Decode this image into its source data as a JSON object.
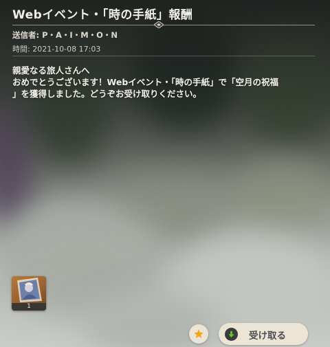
{
  "mail": {
    "title": "Webイベント・「時の手紙」報酬",
    "sender": "送信者: P・A・I・M・O・N",
    "time": "時間: 2021-10-08 17:03",
    "body_lines": [
      "親愛なる旅人さんへ",
      "おめでとうございます！Webイベント・「時の手紙」で「空月の祝福",
      "」を獲得しました。どうぞお受け取りください。"
    ]
  },
  "attachment": {
    "count": "1",
    "icon": "character-portrait-icon"
  },
  "actions": {
    "favorite_icon": "star-icon",
    "claim_label": "受け取る",
    "claim_icon": "arrow-down-icon"
  },
  "colors": {
    "text": "#f2efe8",
    "button_bg": "#ece5d6",
    "star": "#f0a51c",
    "claim_icon": "#6cc42b"
  }
}
